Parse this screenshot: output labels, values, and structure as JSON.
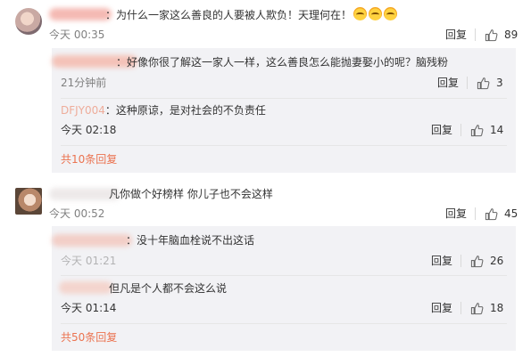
{
  "comments": [
    {
      "username": "晚安宝贝晴",
      "text": "：为什么一家这么善良的人要被人欺负！天理何在！",
      "emoji_count": 3,
      "time": "今天 00:35",
      "reply_label": "回复",
      "likes": "89",
      "replies": [
        {
          "username": "熊猫爱吃竹子",
          "text": "：好像你很了解这一家人一样，这么善良怎么能抛妻娶小的呢？脑残粉",
          "time": "21分钟前",
          "reply_label": "回复",
          "likes": "3"
        },
        {
          "username": "DFJY004",
          "text": "：这种原谅，是对社会的不负责任",
          "time": "今天 02:18",
          "reply_label": "回复",
          "likes": "14"
        }
      ],
      "more_label": "共10条回复"
    },
    {
      "username": "共享单车",
      "text": "凡你做个好榜样 你儿子也不会这样",
      "time": "今天 00:52",
      "reply_label": "回复",
      "likes": "45",
      "replies": [
        {
          "username": "小可爱的大人",
          "text": "：没十年脑血栓说不出这话",
          "time": "今天 01:21",
          "reply_label": "回复",
          "likes": "26"
        },
        {
          "username": "肯定人",
          "text": "但凡是个人都不会这么说",
          "time": "今天 01:14",
          "reply_label": "回复",
          "likes": "18"
        }
      ],
      "more_label": "共50条回复"
    }
  ],
  "colors": {
    "accent": "#eb7350",
    "sub_bg": "#f2f2f5",
    "muted": "#808080"
  },
  "icons": {
    "like": "thumbs-up-icon",
    "emoji": "crying-face-emoji-icon"
  }
}
